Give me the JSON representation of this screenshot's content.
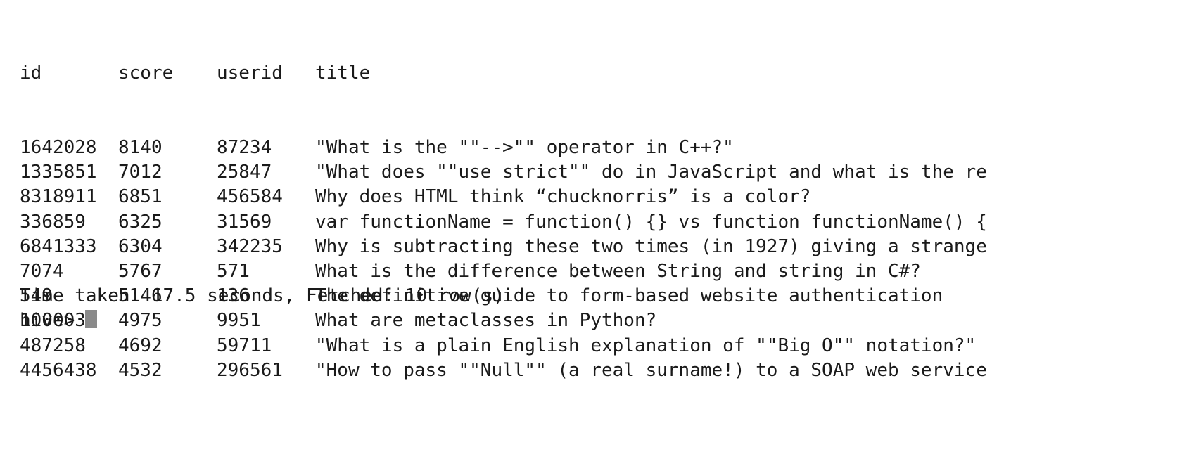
{
  "table": {
    "headers": {
      "id": "id",
      "score": "score",
      "userid": "userid",
      "title": "title"
    },
    "rows": [
      {
        "id": "1642028",
        "score": "8140",
        "userid": "87234",
        "title": "\"What is the \"\"-->\"\" operator in C++?\""
      },
      {
        "id": "1335851",
        "score": "7012",
        "userid": "25847",
        "title": "\"What does \"\"use strict\"\" do in JavaScript and what is the re"
      },
      {
        "id": "8318911",
        "score": "6851",
        "userid": "456584",
        "title": "Why does HTML think “chucknorris” is a color?"
      },
      {
        "id": "336859",
        "score": "6325",
        "userid": "31569",
        "title": "var functionName = function() {} vs function functionName() {"
      },
      {
        "id": "6841333",
        "score": "6304",
        "userid": "342235",
        "title": "Why is subtracting these two times (in 1927) giving a strange"
      },
      {
        "id": "7074",
        "score": "5767",
        "userid": "571",
        "title": "What is the difference between String and string in C#?"
      },
      {
        "id": "549",
        "score": "5146",
        "userid": "136",
        "title": "The definitive guide to form-based website authentication"
      },
      {
        "id": "100003",
        "score": "4975",
        "userid": "9951",
        "title": "What are metaclasses in Python?"
      },
      {
        "id": "487258",
        "score": "4692",
        "userid": "59711",
        "title": "\"What is a plain English explanation of \"\"Big O\"\" notation?\""
      },
      {
        "id": "4456438",
        "score": "4532",
        "userid": "296561",
        "title": "\"How to pass \"\"Null\"\" (a real surname!) to a SOAP web service"
      }
    ]
  },
  "status": {
    "text": "Time taken: 17.5 seconds, Fetched: 10 row(s)"
  },
  "prompt": {
    "text": "hive>"
  },
  "colors": {
    "background": "#ffffff",
    "text": "#1a1a1a",
    "cursor": "#8a8a8a"
  }
}
